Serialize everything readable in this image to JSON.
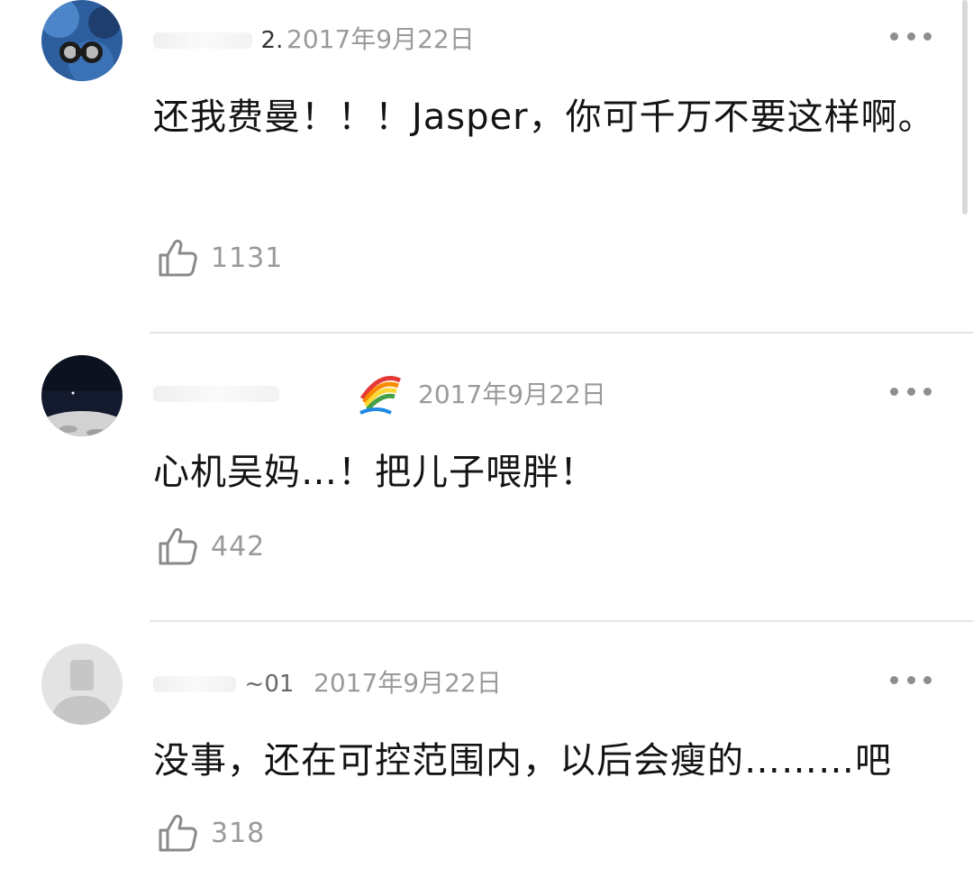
{
  "comments": [
    {
      "username_fragment": "2.",
      "timestamp": "2017年9月22日",
      "text": "还我费曼！！！Jasper，你可千万不要这样啊。",
      "likes": "1131"
    },
    {
      "username_fragment": "",
      "timestamp": "2017年9月22日",
      "text": "心机吴妈…！把儿子喂胖！",
      "likes": "442"
    },
    {
      "username_fragment": "~01",
      "timestamp": "2017年9月22日",
      "text": "没事，还在可控范围内，以后会瘦的………吧",
      "likes": "318"
    }
  ],
  "icons": {
    "more": "more-horizontal-icon",
    "like": "thumbs-up-icon",
    "badge": "rainbow-badge-icon"
  },
  "colors": {
    "timestamp": "#9a9a9a",
    "divider": "#e4e4e4",
    "text": "#141414"
  }
}
